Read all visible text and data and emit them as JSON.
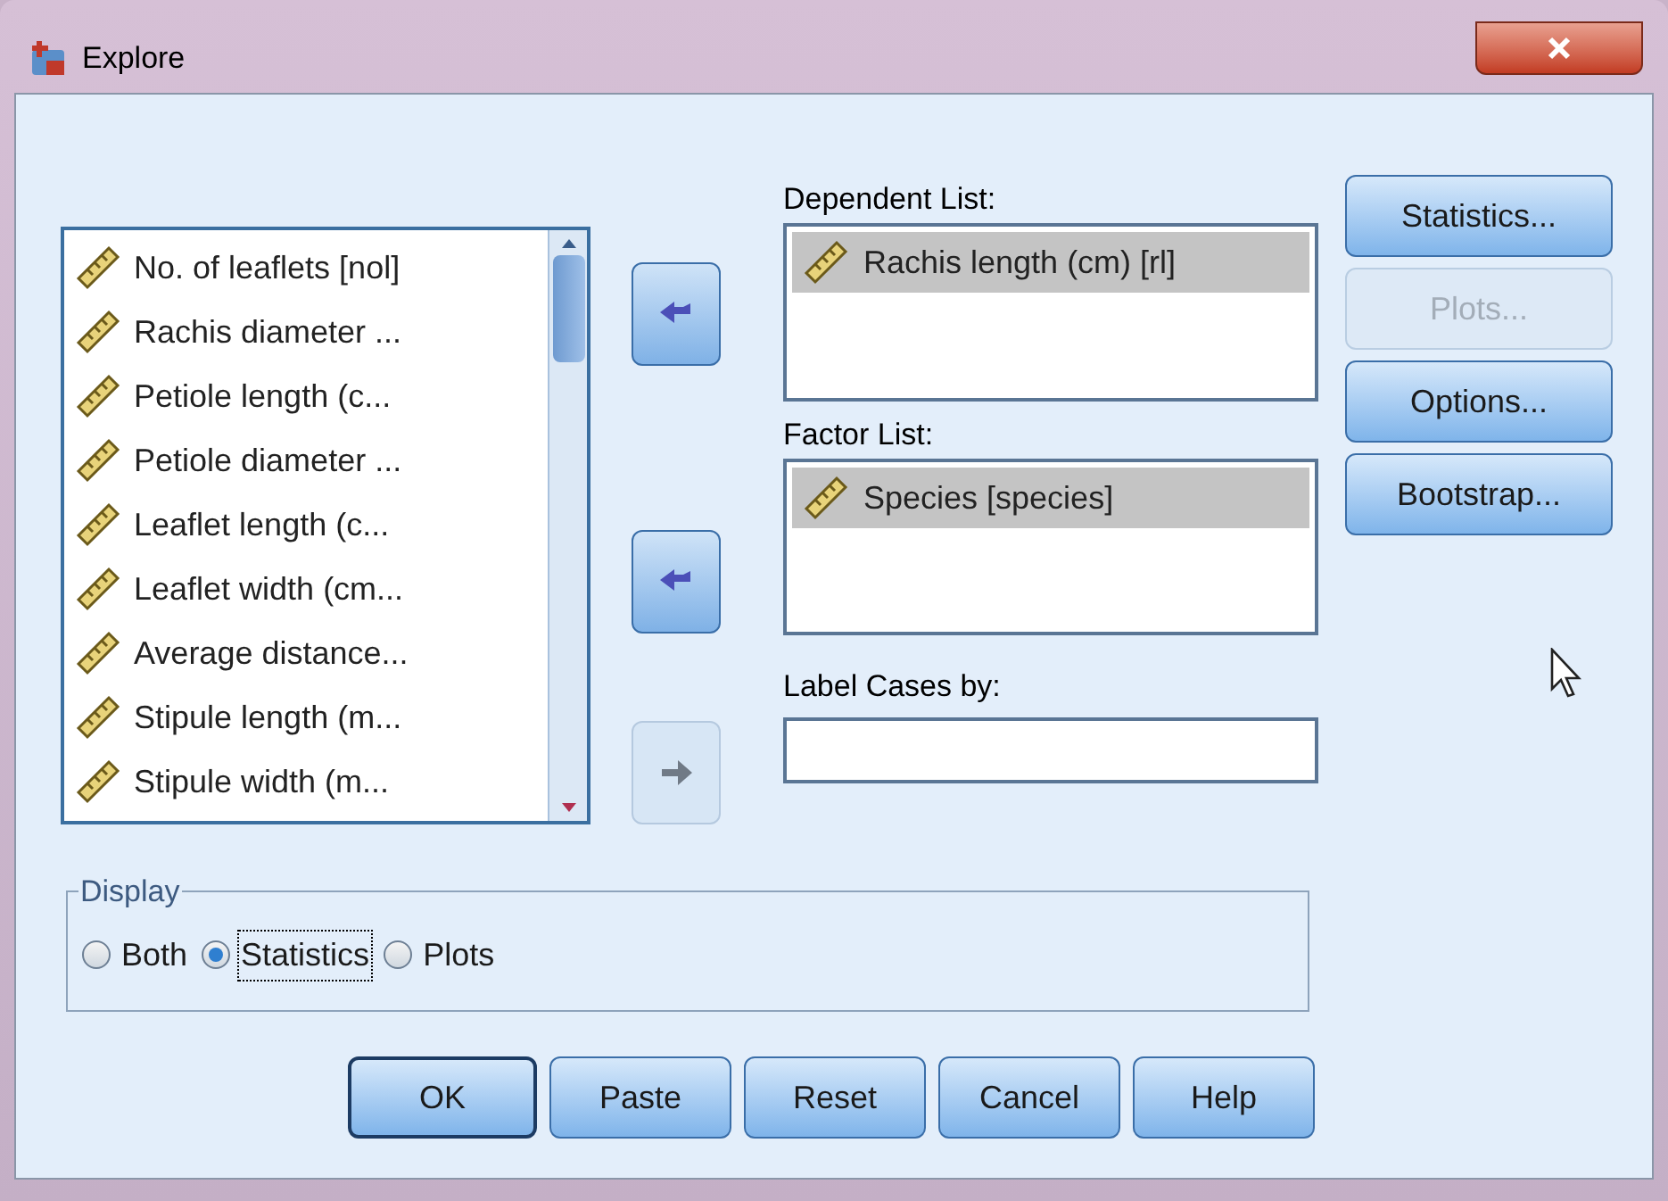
{
  "window": {
    "title": "Explore"
  },
  "variables": [
    {
      "label": "No. of leaflets [nol]"
    },
    {
      "label": "Rachis diameter ..."
    },
    {
      "label": "Petiole length (c..."
    },
    {
      "label": "Petiole diameter ..."
    },
    {
      "label": "Leaflet length (c..."
    },
    {
      "label": "Leaflet width (cm..."
    },
    {
      "label": "Average distance..."
    },
    {
      "label": "Stipule length (m..."
    },
    {
      "label": "Stipule width (m..."
    }
  ],
  "move_buttons": [
    {
      "disabled": false
    },
    {
      "disabled": false
    },
    {
      "disabled": true
    }
  ],
  "dependent_list": {
    "label": "Dependent List:",
    "items": [
      {
        "label": "Rachis length (cm) [rl]",
        "selected": true
      }
    ]
  },
  "factor_list": {
    "label": "Factor List:",
    "items": [
      {
        "label": "Species [species]",
        "selected": true
      }
    ]
  },
  "label_cases": {
    "label": "Label Cases by:"
  },
  "side_buttons": [
    {
      "label": "Statistics...",
      "disabled": false
    },
    {
      "label": "Plots...",
      "disabled": true
    },
    {
      "label": "Options...",
      "disabled": false
    },
    {
      "label": "Bootstrap...",
      "disabled": false
    }
  ],
  "display": {
    "title": "Display",
    "options": [
      {
        "label": "Both",
        "selected": false
      },
      {
        "label": "Statistics",
        "selected": true
      },
      {
        "label": "Plots",
        "selected": false
      }
    ]
  },
  "buttons": [
    {
      "label": "OK",
      "default": true
    },
    {
      "label": "Paste",
      "default": false
    },
    {
      "label": "Reset",
      "default": false
    },
    {
      "label": "Cancel",
      "default": false
    },
    {
      "label": "Help",
      "default": false
    }
  ]
}
